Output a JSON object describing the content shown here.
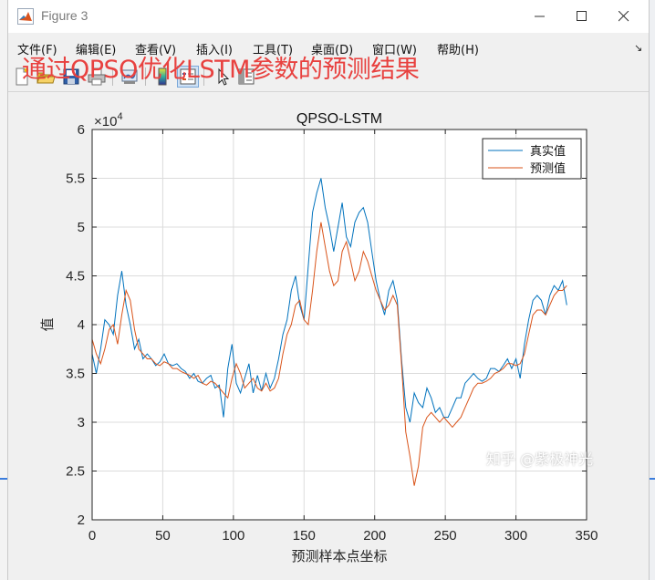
{
  "window": {
    "title": "Figure 3",
    "menu": [
      "文件(F)",
      "编辑(E)",
      "查看(V)",
      "插入(I)",
      "工具(T)",
      "桌面(D)",
      "窗口(W)",
      "帮助(H)"
    ],
    "menu_overflow_icon": "chevron-icon"
  },
  "toolbar_icons": [
    "new-figure-icon",
    "open-file-icon",
    "save-icon",
    "print-icon",
    "link-icon",
    "colorbar-icon",
    "legend-icon",
    "pointer-icon",
    "property-inspector-icon"
  ],
  "annotation": "通过QPSO优化LSTM参数的预测结果",
  "watermark": "知乎 @紫极神光",
  "colors": {
    "true_series": "#0072BD",
    "pred_series": "#D95319",
    "annotation": "#E8413F"
  },
  "chart_data": {
    "type": "line",
    "title": "QPSO-LSTM",
    "xlabel": "预测样本点坐标",
    "ylabel": "值",
    "xlim": [
      0,
      350
    ],
    "ylim": [
      20000,
      60000
    ],
    "y_exponent_label": "×10^4",
    "xticks": [
      0,
      50,
      100,
      150,
      200,
      250,
      300,
      350
    ],
    "yticks": [
      2,
      2.5,
      3,
      3.5,
      4,
      4.5,
      5,
      5.5,
      6
    ],
    "grid": true,
    "legend_position": "top-right",
    "series": [
      {
        "name": "真实值",
        "color": "#0072BD",
        "x": [
          0,
          3,
          6,
          9,
          12,
          15,
          18,
          21,
          24,
          27,
          30,
          33,
          36,
          39,
          42,
          45,
          48,
          51,
          54,
          57,
          60,
          63,
          66,
          69,
          72,
          75,
          78,
          81,
          84,
          87,
          90,
          93,
          96,
          99,
          102,
          105,
          108,
          111,
          114,
          117,
          120,
          123,
          126,
          129,
          132,
          135,
          138,
          141,
          144,
          147,
          150,
          153,
          156,
          159,
          162,
          165,
          168,
          171,
          174,
          177,
          180,
          183,
          186,
          189,
          192,
          195,
          198,
          201,
          204,
          207,
          210,
          213,
          216,
          219,
          222,
          225,
          228,
          231,
          234,
          237,
          240,
          243,
          246,
          249,
          252,
          255,
          258,
          261,
          264,
          267,
          270,
          273,
          276,
          279,
          282,
          285,
          288,
          291,
          294,
          297,
          300,
          303,
          306,
          309,
          312,
          315,
          318,
          321,
          324,
          327,
          330,
          333,
          336
        ],
        "y": [
          37000,
          35000,
          37500,
          40500,
          40000,
          39000,
          43000,
          45500,
          42000,
          40000,
          37500,
          38500,
          36500,
          37000,
          36500,
          35800,
          36200,
          37000,
          36000,
          35800,
          36000,
          35500,
          35200,
          34500,
          35000,
          34200,
          34000,
          34500,
          34800,
          33500,
          33800,
          30500,
          35500,
          38000,
          34000,
          33000,
          34500,
          36000,
          33000,
          34800,
          33200,
          35000,
          33500,
          34500,
          36500,
          39000,
          40500,
          43500,
          45000,
          42000,
          40500,
          46000,
          51500,
          53500,
          55000,
          52000,
          50000,
          47500,
          50000,
          52500,
          49000,
          48000,
          50500,
          51500,
          52000,
          50500,
          47500,
          44500,
          42500,
          41000,
          43500,
          44500,
          42500,
          36500,
          31500,
          30000,
          33000,
          32000,
          31500,
          33500,
          32500,
          31000,
          31500,
          30500,
          30500,
          31500,
          32500,
          32500,
          34000,
          34500,
          35000,
          34500,
          34200,
          34500,
          35500,
          35500,
          35200,
          35800,
          36500,
          35500,
          36500,
          34500,
          38000,
          40500,
          42500,
          43000,
          42500,
          41000,
          43000,
          44000,
          43500,
          44500,
          42000
        ]
      },
      {
        "name": "预测值",
        "color": "#D95319",
        "x": [
          0,
          3,
          6,
          9,
          12,
          15,
          18,
          21,
          24,
          27,
          30,
          33,
          36,
          39,
          42,
          45,
          48,
          51,
          54,
          57,
          60,
          63,
          66,
          69,
          72,
          75,
          78,
          81,
          84,
          87,
          90,
          93,
          96,
          99,
          102,
          105,
          108,
          111,
          114,
          117,
          120,
          123,
          126,
          129,
          132,
          135,
          138,
          141,
          144,
          147,
          150,
          153,
          156,
          159,
          162,
          165,
          168,
          171,
          174,
          177,
          180,
          183,
          186,
          189,
          192,
          195,
          198,
          201,
          204,
          207,
          210,
          213,
          216,
          219,
          222,
          225,
          228,
          231,
          234,
          237,
          240,
          243,
          246,
          249,
          252,
          255,
          258,
          261,
          264,
          267,
          270,
          273,
          276,
          279,
          282,
          285,
          288,
          291,
          294,
          297,
          300,
          303,
          306,
          309,
          312,
          315,
          318,
          321,
          324,
          327,
          330,
          333,
          336
        ],
        "y": [
          38500,
          37000,
          36000,
          37500,
          39500,
          40000,
          38000,
          41000,
          43500,
          42500,
          39500,
          37500,
          37000,
          36500,
          36500,
          36000,
          35800,
          36200,
          36000,
          35500,
          35500,
          35200,
          35000,
          34800,
          34500,
          34800,
          34000,
          33800,
          34200,
          34000,
          33500,
          33000,
          32500,
          34500,
          36000,
          35000,
          33500,
          34000,
          34500,
          33500,
          33200,
          34000,
          33200,
          33500,
          34500,
          37000,
          39000,
          40000,
          42000,
          42500,
          40500,
          40000,
          43500,
          47500,
          50500,
          48000,
          45500,
          44000,
          44500,
          47500,
          48500,
          46500,
          44500,
          45500,
          47500,
          46500,
          45000,
          43500,
          42500,
          41500,
          42000,
          43000,
          42000,
          36000,
          29000,
          26500,
          23500,
          25500,
          29500,
          30500,
          31000,
          30500,
          30000,
          30500,
          30000,
          29500,
          30000,
          30500,
          31500,
          32500,
          33500,
          34000,
          34000,
          34200,
          34500,
          35000,
          35200,
          35500,
          36000,
          36000,
          35800,
          36000,
          37000,
          39000,
          41000,
          41500,
          41500,
          41000,
          42000,
          43000,
          43500,
          43500,
          44000
        ]
      }
    ]
  }
}
